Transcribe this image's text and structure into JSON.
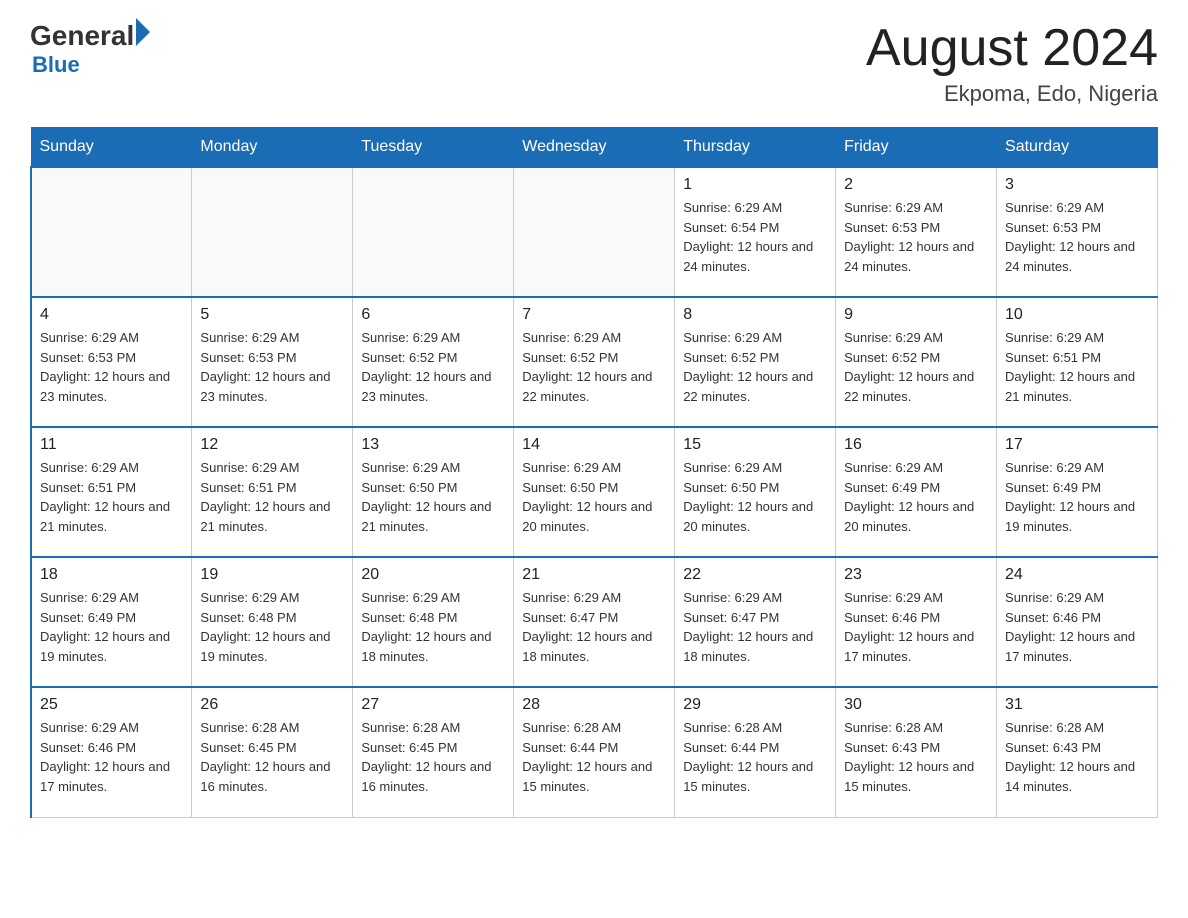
{
  "header": {
    "logo_general": "General",
    "logo_blue": "Blue",
    "title": "August 2024",
    "subtitle": "Ekpoma, Edo, Nigeria"
  },
  "calendar": {
    "days_of_week": [
      "Sunday",
      "Monday",
      "Tuesday",
      "Wednesday",
      "Thursday",
      "Friday",
      "Saturday"
    ],
    "weeks": [
      [
        {
          "day": "",
          "info": ""
        },
        {
          "day": "",
          "info": ""
        },
        {
          "day": "",
          "info": ""
        },
        {
          "day": "",
          "info": ""
        },
        {
          "day": "1",
          "info": "Sunrise: 6:29 AM\nSunset: 6:54 PM\nDaylight: 12 hours and 24 minutes."
        },
        {
          "day": "2",
          "info": "Sunrise: 6:29 AM\nSunset: 6:53 PM\nDaylight: 12 hours and 24 minutes."
        },
        {
          "day": "3",
          "info": "Sunrise: 6:29 AM\nSunset: 6:53 PM\nDaylight: 12 hours and 24 minutes."
        }
      ],
      [
        {
          "day": "4",
          "info": "Sunrise: 6:29 AM\nSunset: 6:53 PM\nDaylight: 12 hours and 23 minutes."
        },
        {
          "day": "5",
          "info": "Sunrise: 6:29 AM\nSunset: 6:53 PM\nDaylight: 12 hours and 23 minutes."
        },
        {
          "day": "6",
          "info": "Sunrise: 6:29 AM\nSunset: 6:52 PM\nDaylight: 12 hours and 23 minutes."
        },
        {
          "day": "7",
          "info": "Sunrise: 6:29 AM\nSunset: 6:52 PM\nDaylight: 12 hours and 22 minutes."
        },
        {
          "day": "8",
          "info": "Sunrise: 6:29 AM\nSunset: 6:52 PM\nDaylight: 12 hours and 22 minutes."
        },
        {
          "day": "9",
          "info": "Sunrise: 6:29 AM\nSunset: 6:52 PM\nDaylight: 12 hours and 22 minutes."
        },
        {
          "day": "10",
          "info": "Sunrise: 6:29 AM\nSunset: 6:51 PM\nDaylight: 12 hours and 21 minutes."
        }
      ],
      [
        {
          "day": "11",
          "info": "Sunrise: 6:29 AM\nSunset: 6:51 PM\nDaylight: 12 hours and 21 minutes."
        },
        {
          "day": "12",
          "info": "Sunrise: 6:29 AM\nSunset: 6:51 PM\nDaylight: 12 hours and 21 minutes."
        },
        {
          "day": "13",
          "info": "Sunrise: 6:29 AM\nSunset: 6:50 PM\nDaylight: 12 hours and 21 minutes."
        },
        {
          "day": "14",
          "info": "Sunrise: 6:29 AM\nSunset: 6:50 PM\nDaylight: 12 hours and 20 minutes."
        },
        {
          "day": "15",
          "info": "Sunrise: 6:29 AM\nSunset: 6:50 PM\nDaylight: 12 hours and 20 minutes."
        },
        {
          "day": "16",
          "info": "Sunrise: 6:29 AM\nSunset: 6:49 PM\nDaylight: 12 hours and 20 minutes."
        },
        {
          "day": "17",
          "info": "Sunrise: 6:29 AM\nSunset: 6:49 PM\nDaylight: 12 hours and 19 minutes."
        }
      ],
      [
        {
          "day": "18",
          "info": "Sunrise: 6:29 AM\nSunset: 6:49 PM\nDaylight: 12 hours and 19 minutes."
        },
        {
          "day": "19",
          "info": "Sunrise: 6:29 AM\nSunset: 6:48 PM\nDaylight: 12 hours and 19 minutes."
        },
        {
          "day": "20",
          "info": "Sunrise: 6:29 AM\nSunset: 6:48 PM\nDaylight: 12 hours and 18 minutes."
        },
        {
          "day": "21",
          "info": "Sunrise: 6:29 AM\nSunset: 6:47 PM\nDaylight: 12 hours and 18 minutes."
        },
        {
          "day": "22",
          "info": "Sunrise: 6:29 AM\nSunset: 6:47 PM\nDaylight: 12 hours and 18 minutes."
        },
        {
          "day": "23",
          "info": "Sunrise: 6:29 AM\nSunset: 6:46 PM\nDaylight: 12 hours and 17 minutes."
        },
        {
          "day": "24",
          "info": "Sunrise: 6:29 AM\nSunset: 6:46 PM\nDaylight: 12 hours and 17 minutes."
        }
      ],
      [
        {
          "day": "25",
          "info": "Sunrise: 6:29 AM\nSunset: 6:46 PM\nDaylight: 12 hours and 17 minutes."
        },
        {
          "day": "26",
          "info": "Sunrise: 6:28 AM\nSunset: 6:45 PM\nDaylight: 12 hours and 16 minutes."
        },
        {
          "day": "27",
          "info": "Sunrise: 6:28 AM\nSunset: 6:45 PM\nDaylight: 12 hours and 16 minutes."
        },
        {
          "day": "28",
          "info": "Sunrise: 6:28 AM\nSunset: 6:44 PM\nDaylight: 12 hours and 15 minutes."
        },
        {
          "day": "29",
          "info": "Sunrise: 6:28 AM\nSunset: 6:44 PM\nDaylight: 12 hours and 15 minutes."
        },
        {
          "day": "30",
          "info": "Sunrise: 6:28 AM\nSunset: 6:43 PM\nDaylight: 12 hours and 15 minutes."
        },
        {
          "day": "31",
          "info": "Sunrise: 6:28 AM\nSunset: 6:43 PM\nDaylight: 12 hours and 14 minutes."
        }
      ]
    ]
  }
}
